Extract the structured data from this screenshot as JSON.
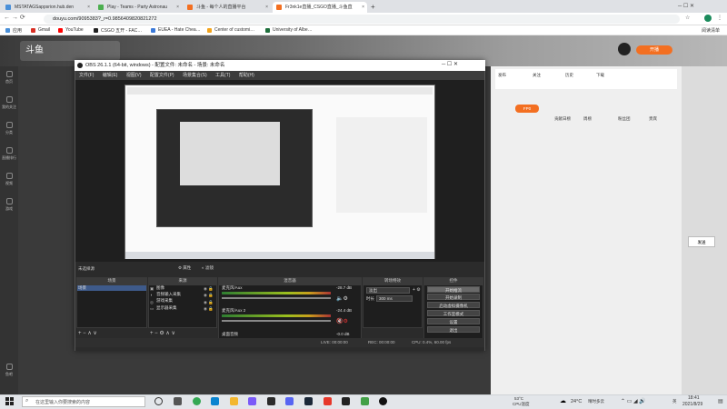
{
  "browser": {
    "tabs": [
      {
        "label": "MSTATAGSappsrion.hub.den",
        "color": "#4a90d9"
      },
      {
        "label": "Play - Teams - Party Astronau",
        "color": "#4caf50"
      },
      {
        "label": "斗鱼 - 每个人的直播平台",
        "color": "#f36f21"
      },
      {
        "label": "Fr3nk1e直播_CSGO直播_斗鱼直",
        "color": "#f36f21"
      }
    ],
    "new_tab": "+",
    "url": "douyu.com/9095383?_r=0.9856409820821272",
    "bookmarks": [
      {
        "label": "应用",
        "color": "#4a90d9"
      },
      {
        "label": "Gmail",
        "color": "#d93025"
      },
      {
        "label": "YouTube",
        "color": "#ff0000"
      },
      {
        "label": "CSGO 五开 - FAC…",
        "color": "#222222"
      },
      {
        "label": "EUEA - Hate Chea…",
        "color": "#3b7ad9"
      },
      {
        "label": "Center of customi…",
        "color": "#f3a41c"
      },
      {
        "label": "University of Albe…",
        "color": "#1f6f3c"
      }
    ],
    "reading_list": "阅读清单"
  },
  "site": {
    "left_nav": [
      "首页",
      "我的关注",
      "分类",
      "直播排行",
      "视频",
      "游戏",
      "鱼吧"
    ],
    "right_actions": [
      "发布",
      "关注",
      "历史",
      "下载",
      "手机"
    ],
    "tabs": [
      "贡献日榜",
      "周榜",
      "粉丝团",
      "贵宾"
    ],
    "fans_label": "FP0",
    "send_label": "发送"
  },
  "obs": {
    "title": "OBS 26.1.1 (64-bit, windows) - 配置文件: 未命名 - 场景: 未命名",
    "menu": [
      "文件(F)",
      "编辑(E)",
      "视图(V)",
      "配置文件(P)",
      "场景集合(S)",
      "工具(T)",
      "帮助(H)"
    ],
    "no_source": "未选择源",
    "props_btn": "属性",
    "filters_btn": "滤镜",
    "docks": [
      "场景",
      "来源",
      "混音器",
      "转场特效",
      "控件"
    ],
    "scenes": [
      "场景"
    ],
    "sources": [
      "图像",
      "音频输入采集",
      "游戏采集",
      "显示器采集"
    ],
    "mixer": [
      {
        "name": "麦克风/Aux",
        "db": "-28.7 dB"
      },
      {
        "name": "麦克风/Aux 2",
        "db": "-24.4 dB"
      },
      {
        "name": "桌面音频",
        "db": "-0.0 dB"
      }
    ],
    "transition": {
      "type": "淡出",
      "duration_label": "时长",
      "duration": "300 ms"
    },
    "controls": [
      "开始推流",
      "开始录制",
      "启动虚拟摄像机",
      "工作室模式",
      "设置",
      "退出"
    ],
    "status": {
      "live": "LIVE: 00:00:00",
      "rec": "REC: 00:00:00",
      "cpu": "CPU: 0.4%, 60.00 fps"
    }
  },
  "taskbar": {
    "search_placeholder": "在这里输入你要搜索的内容",
    "weather_temp": "53°C",
    "weather_label": "CPU温度",
    "temp": "24°C",
    "weather": "晴时多云",
    "ime": "英",
    "time": "18:41",
    "date": "2021/8/29"
  }
}
